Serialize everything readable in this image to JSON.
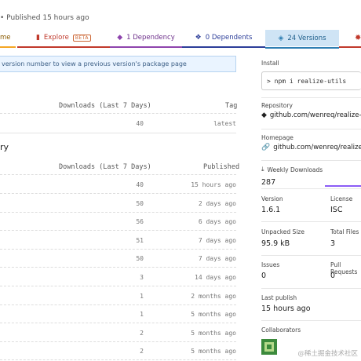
{
  "meta": {
    "text": "• Published 15 hours ago"
  },
  "tabs": [
    {
      "label": "me",
      "color": "#f5a623"
    },
    {
      "label": "Explore",
      "badge": "BETA",
      "color": "#c0392b"
    },
    {
      "label": "1 Dependency",
      "color": "#8e44ad"
    },
    {
      "label": "0 Dependents",
      "color": "#2c3e99"
    },
    {
      "label": "24 Versions",
      "color": "#2f7fb3"
    },
    {
      "label": "",
      "color": "#c0392b"
    }
  ],
  "banner": {
    "text": "version number to view a previous version's package page"
  },
  "current_tags": {
    "headers": {
      "downloads": "Downloads (Last 7 Days)",
      "tag": "Tag"
    },
    "rows": [
      {
        "downloads": "40",
        "tag": "latest"
      }
    ]
  },
  "history": {
    "title": "ry",
    "headers": {
      "downloads": "Downloads (Last 7 Days)",
      "published": "Published"
    },
    "rows": [
      {
        "downloads": "40",
        "published": "15 hours ago"
      },
      {
        "downloads": "50",
        "published": "2 days ago"
      },
      {
        "downloads": "56",
        "published": "6 days ago"
      },
      {
        "downloads": "51",
        "published": "7 days ago"
      },
      {
        "downloads": "50",
        "published": "7 days ago"
      },
      {
        "downloads": "3",
        "published": "14 days ago"
      },
      {
        "downloads": "1",
        "published": "2 months ago"
      },
      {
        "downloads": "1",
        "published": "5 months ago"
      },
      {
        "downloads": "2",
        "published": "5 months ago"
      },
      {
        "downloads": "2",
        "published": "5 months ago"
      }
    ]
  },
  "sidebar": {
    "install": {
      "label": "Install",
      "command": "> npm i realize-utils"
    },
    "repository": {
      "label": "Repository",
      "link": "github.com/wenreq/realize-utils"
    },
    "homepage": {
      "label": "Homepage",
      "link": "github.com/wenreq/realize-utils"
    },
    "weekly": {
      "label": "Weekly Downloads",
      "value": "287"
    },
    "version": {
      "label": "Version",
      "value": "1.6.1"
    },
    "license": {
      "label": "License",
      "value": "ISC"
    },
    "unpacked": {
      "label": "Unpacked Size",
      "value": "95.9 kB"
    },
    "total_files": {
      "label": "Total Files",
      "value": "3"
    },
    "issues": {
      "label": "Issues",
      "value": "0"
    },
    "pull_requests": {
      "label": "Pull Requests",
      "value": "0"
    },
    "last_publish": {
      "label": "Last publish",
      "value": "15 hours ago"
    },
    "collaborators": {
      "label": "Collaborators"
    }
  },
  "watermark": "@稀土掘金技术社区"
}
